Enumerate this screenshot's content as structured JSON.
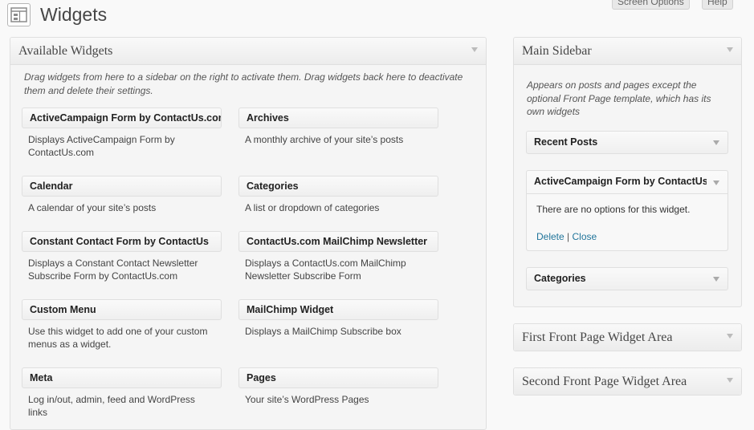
{
  "header": {
    "title": "Widgets",
    "screen_options_label": "Screen Options",
    "help_label": "Help",
    "icon": "widgets-icon"
  },
  "available": {
    "title": "Available Widgets",
    "description": "Drag widgets from here to a sidebar on the right to activate them. Drag widgets back here to deactivate them and delete their settings.",
    "widgets": [
      {
        "title": "ActiveCampaign Form by ContactUs.com",
        "desc": "Displays ActiveCampaign Form by ContactUs.com"
      },
      {
        "title": "Archives",
        "desc": "A monthly archive of your site’s posts"
      },
      {
        "title": "Calendar",
        "desc": "A calendar of your site’s posts"
      },
      {
        "title": "Categories",
        "desc": "A list or dropdown of categories"
      },
      {
        "title": "Constant Contact Form by ContactUs",
        "desc": "Displays a Constant Contact Newsletter Subscribe Form by ContactUs.com"
      },
      {
        "title": "ContactUs.com MailChimp Newsletter",
        "desc": "Displays a ContactUs.com MailChimp Newsletter Subscribe Form"
      },
      {
        "title": "Custom Menu",
        "desc": "Use this widget to add one of your custom menus as a widget."
      },
      {
        "title": "MailChimp Widget",
        "desc": "Displays a MailChimp Subscribe box"
      },
      {
        "title": "Meta",
        "desc": "Log in/out, admin, feed and WordPress links"
      },
      {
        "title": "Pages",
        "desc": "Your site’s WordPress Pages"
      }
    ]
  },
  "main_sidebar": {
    "title": "Main Sidebar",
    "description": "Appears on posts and pages except the optional Front Page template, which has its own widgets",
    "widgets": [
      {
        "title": "Recent Posts"
      },
      {
        "title": "ActiveCampaign Form by ContactUs.com",
        "body": "There are no options for this widget.",
        "delete_label": "Delete",
        "separator": "|",
        "close_label": "Close"
      },
      {
        "title": "Categories"
      }
    ]
  },
  "other_sidebars": [
    {
      "title": "First Front Page Widget Area"
    },
    {
      "title": "Second Front Page Widget Area"
    }
  ]
}
